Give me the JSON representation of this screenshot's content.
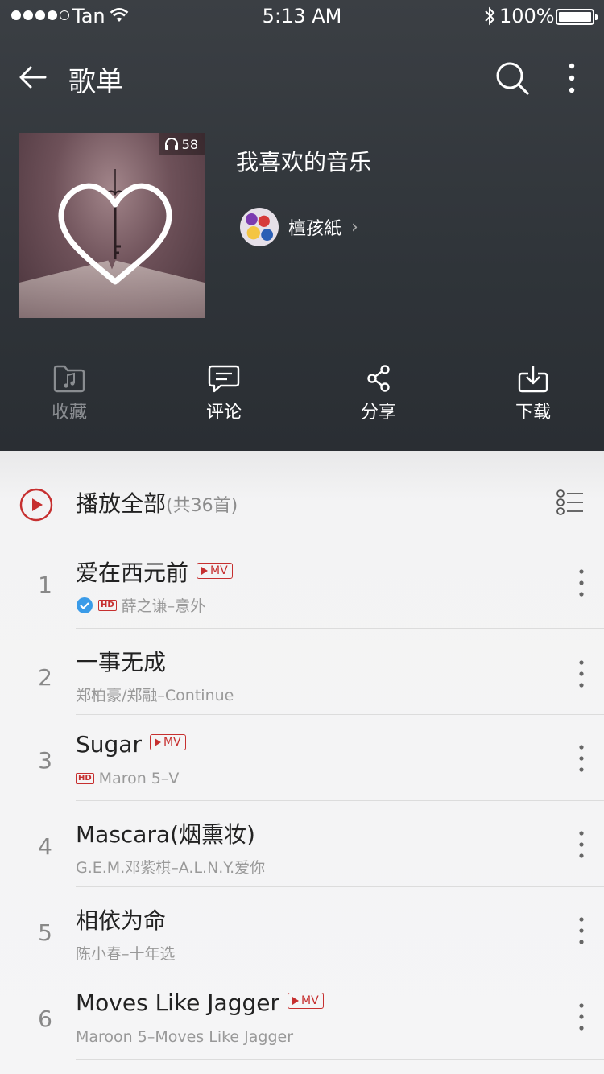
{
  "status_bar": {
    "carrier": "Tan",
    "time": "5:13 AM",
    "battery": "100%"
  },
  "nav": {
    "title": "歌单"
  },
  "playlist": {
    "title": "我喜欢的音乐",
    "play_count": "58",
    "creator": "檀孩紙"
  },
  "actions": [
    {
      "label": "收藏",
      "icon": "folder-music-icon",
      "enabled": false
    },
    {
      "label": "评论",
      "icon": "comment-icon",
      "enabled": true
    },
    {
      "label": "分享",
      "icon": "share-icon",
      "enabled": true
    },
    {
      "label": "下载",
      "icon": "download-icon",
      "enabled": true
    }
  ],
  "play_all": {
    "label": "播放全部",
    "count": "(共36首)"
  },
  "songs": [
    {
      "index": "1",
      "title": "爱在西元前",
      "mv": true,
      "hd": true,
      "downloaded": true,
      "subtitle": "薛之谦–意外"
    },
    {
      "index": "2",
      "title": "一事无成",
      "mv": false,
      "hd": false,
      "downloaded": false,
      "subtitle": "郑柏豪/郑融–Continue"
    },
    {
      "index": "3",
      "title": "Sugar",
      "mv": true,
      "hd": true,
      "downloaded": false,
      "subtitle": "Maron 5–V"
    },
    {
      "index": "4",
      "title": "Mascara(烟熏妆)",
      "mv": false,
      "hd": false,
      "downloaded": false,
      "subtitle": "G.E.M.邓紫棋–A.L.N.Y.爱你"
    },
    {
      "index": "5",
      "title": "相依为命",
      "mv": false,
      "hd": false,
      "downloaded": false,
      "subtitle": "陈小春–十年选"
    },
    {
      "index": "6",
      "title": "Moves Like Jagger",
      "mv": true,
      "hd": false,
      "downloaded": false,
      "subtitle": "Maroon 5–Moves Like Jagger"
    }
  ],
  "badges": {
    "mv": "MV",
    "hd": "HD"
  },
  "colors": {
    "accent": "#c62f2f",
    "header_bg": "#2f3439",
    "check": "#3a9be8"
  }
}
